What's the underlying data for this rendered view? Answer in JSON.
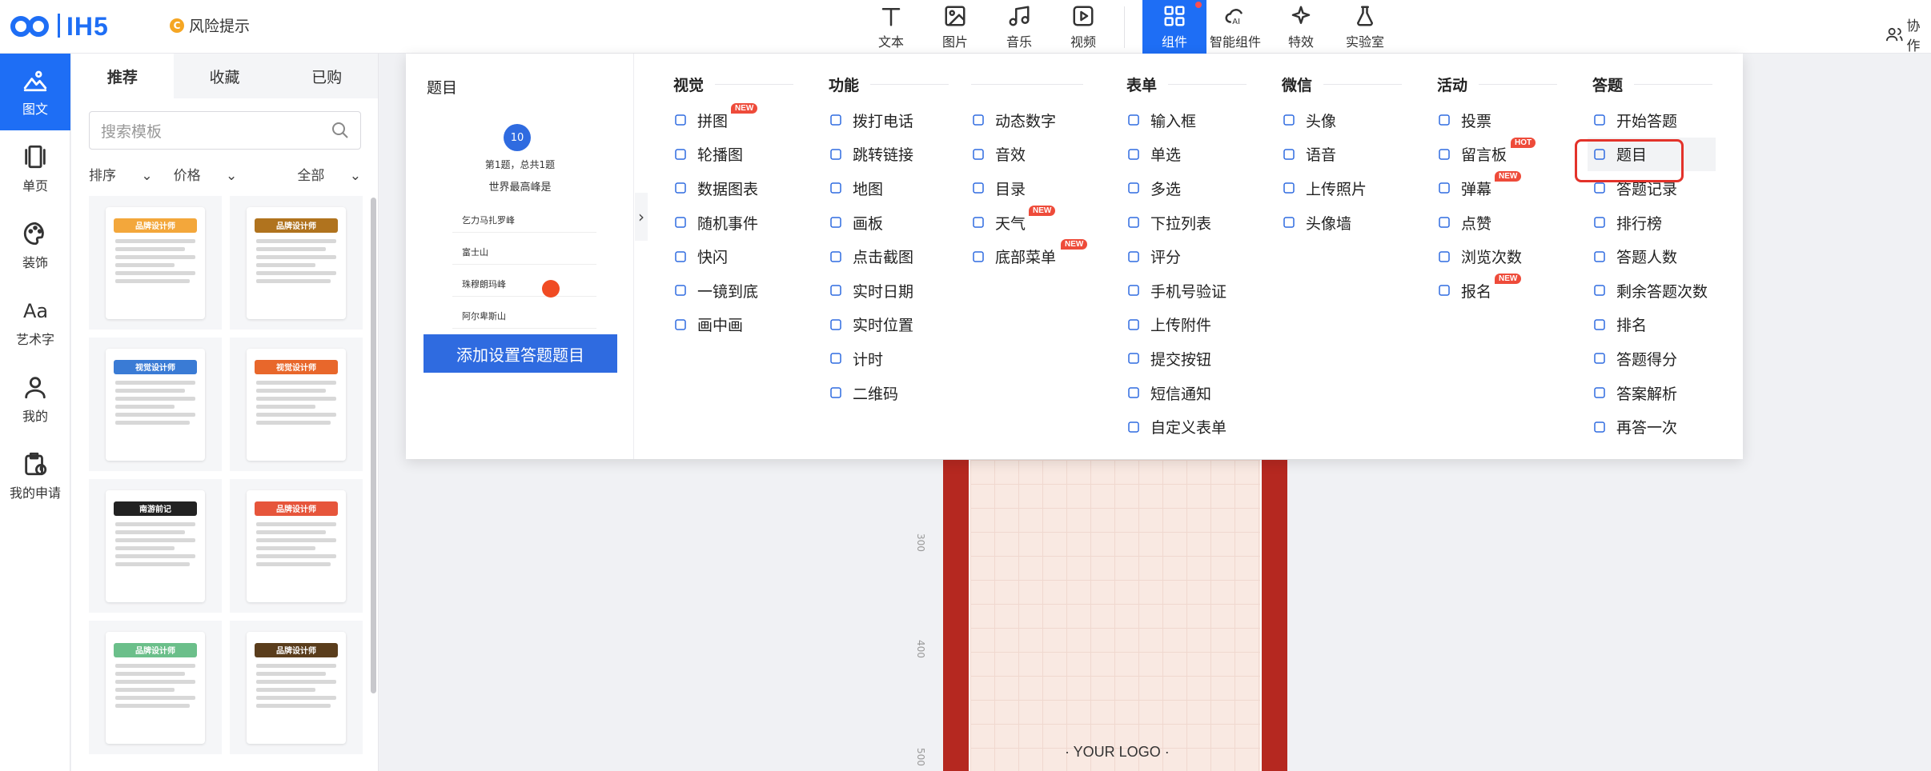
{
  "app": {
    "logo": "IH5",
    "risk_notice": "风险提示",
    "collab_label": "协作"
  },
  "toolbar": [
    {
      "label": "文本",
      "icon": "text-icon"
    },
    {
      "label": "图片",
      "icon": "image-icon"
    },
    {
      "label": "音乐",
      "icon": "music-icon"
    },
    {
      "label": "视频",
      "icon": "video-icon"
    },
    {
      "label": "组件",
      "icon": "component-icon",
      "active": true
    },
    {
      "label": "智能组件",
      "icon": "ai-icon"
    },
    {
      "label": "特效",
      "icon": "sparkle-icon"
    },
    {
      "label": "实验室",
      "icon": "flask-icon"
    }
  ],
  "rail": [
    {
      "label": "图文",
      "icon": "image-text-icon",
      "active": true
    },
    {
      "label": "单页",
      "icon": "page-icon"
    },
    {
      "label": "装饰",
      "icon": "palette-icon"
    },
    {
      "label": "艺术字",
      "icon": "art-text-icon"
    },
    {
      "label": "我的",
      "icon": "user-icon"
    },
    {
      "label": "我的申请",
      "icon": "apply-icon"
    }
  ],
  "template_panel": {
    "tabs": [
      "推荐",
      "收藏",
      "已购"
    ],
    "search_placeholder": "搜索模板",
    "sort_label": "排序",
    "price_label": "价格",
    "all_label": "全部",
    "cards": [
      {
        "title": "品牌设计师",
        "color": "#f3a73b"
      },
      {
        "title": "品牌设计师",
        "color": "#b0731e"
      },
      {
        "title": "视觉设计师",
        "color": "#3a7bd5"
      },
      {
        "title": "视觉设计师",
        "color": "#e8672b"
      },
      {
        "title": "南游前记",
        "color": "#222222"
      },
      {
        "title": "品牌设计师",
        "color": "#e6553b"
      },
      {
        "title": "品牌设计师",
        "color": "#6bbf8a"
      },
      {
        "title": "品牌设计师",
        "color": "#5a3d1c"
      }
    ]
  },
  "preview": {
    "title": "题目",
    "question_number": "10",
    "question_info": "第1题，总共1题",
    "question_text": "世界最高峰是",
    "options": [
      "乞力马扎罗峰",
      "富士山",
      "珠穆朗玛峰",
      "阿尔卑斯山"
    ],
    "add_button": "添加设置答题题目"
  },
  "columns": [
    {
      "title": "视觉",
      "items": [
        {
          "label": "拼图",
          "badge": "NEW"
        },
        {
          "label": "轮播图"
        },
        {
          "label": "数据图表"
        },
        {
          "label": "随机事件"
        },
        {
          "label": "快闪"
        },
        {
          "label": "一镜到底"
        },
        {
          "label": "画中画"
        }
      ]
    },
    {
      "title": "功能",
      "items": [
        {
          "label": "拨打电话"
        },
        {
          "label": "跳转链接"
        },
        {
          "label": "地图"
        },
        {
          "label": "画板"
        },
        {
          "label": "点击截图"
        },
        {
          "label": "实时日期"
        },
        {
          "label": "实时位置"
        },
        {
          "label": "计时"
        },
        {
          "label": "二维码"
        }
      ]
    },
    {
      "title": "",
      "items": [
        {
          "label": "动态数字"
        },
        {
          "label": "音效"
        },
        {
          "label": "目录"
        },
        {
          "label": "天气",
          "badge": "NEW"
        },
        {
          "label": "底部菜单",
          "badge": "NEW"
        }
      ]
    },
    {
      "title": "表单",
      "items": [
        {
          "label": "输入框"
        },
        {
          "label": "单选"
        },
        {
          "label": "多选"
        },
        {
          "label": "下拉列表"
        },
        {
          "label": "评分"
        },
        {
          "label": "手机号验证"
        },
        {
          "label": "上传附件"
        },
        {
          "label": "提交按钮"
        },
        {
          "label": "短信通知"
        },
        {
          "label": "自定义表单"
        }
      ]
    },
    {
      "title": "微信",
      "items": [
        {
          "label": "头像"
        },
        {
          "label": "语音"
        },
        {
          "label": "上传照片"
        },
        {
          "label": "头像墙"
        }
      ]
    },
    {
      "title": "活动",
      "items": [
        {
          "label": "投票"
        },
        {
          "label": "留言板",
          "badge": "HOT"
        },
        {
          "label": "弹幕",
          "badge": "NEW"
        },
        {
          "label": "点赞"
        },
        {
          "label": "浏览次数"
        },
        {
          "label": "报名",
          "badge": "NEW"
        }
      ]
    },
    {
      "title": "答题",
      "items": [
        {
          "label": "开始答题"
        },
        {
          "label": "题目",
          "highlight": true
        },
        {
          "label": "答题记录"
        },
        {
          "label": "排行榜"
        },
        {
          "label": "答题人数"
        },
        {
          "label": "剩余答题次数"
        },
        {
          "label": "排名"
        },
        {
          "label": "答题得分"
        },
        {
          "label": "答案解析"
        },
        {
          "label": "再答一次"
        }
      ]
    }
  ],
  "canvas": {
    "logo_text": "· YOUR LOGO ·",
    "ruler": [
      "300",
      "400",
      "500"
    ]
  }
}
